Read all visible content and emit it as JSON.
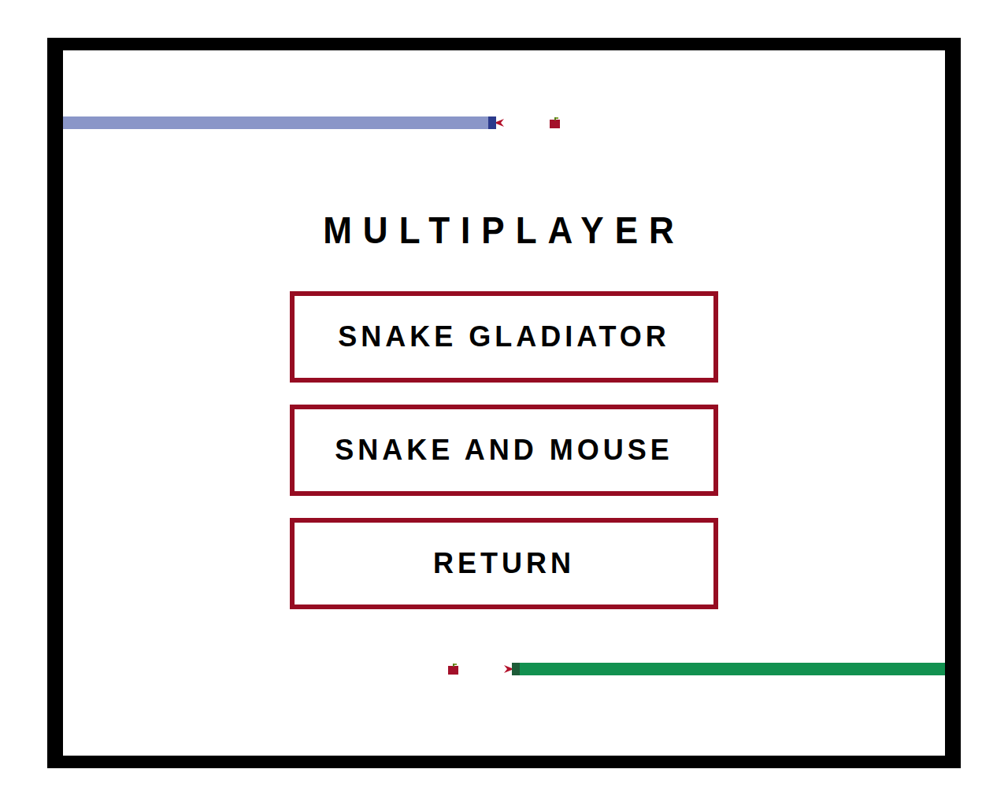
{
  "screen": {
    "title": "MULTIPLAYER"
  },
  "menu": [
    {
      "label": "SNAKE GLADIATOR"
    },
    {
      "label": "SNAKE AND MOUSE"
    },
    {
      "label": "RETURN"
    }
  ],
  "snakes": [
    {
      "color": "#8a96c8",
      "head_color": "#2b3a8c",
      "heading": "right"
    },
    {
      "color": "#129150",
      "head_color": "#1d5c38",
      "heading": "left"
    }
  ]
}
